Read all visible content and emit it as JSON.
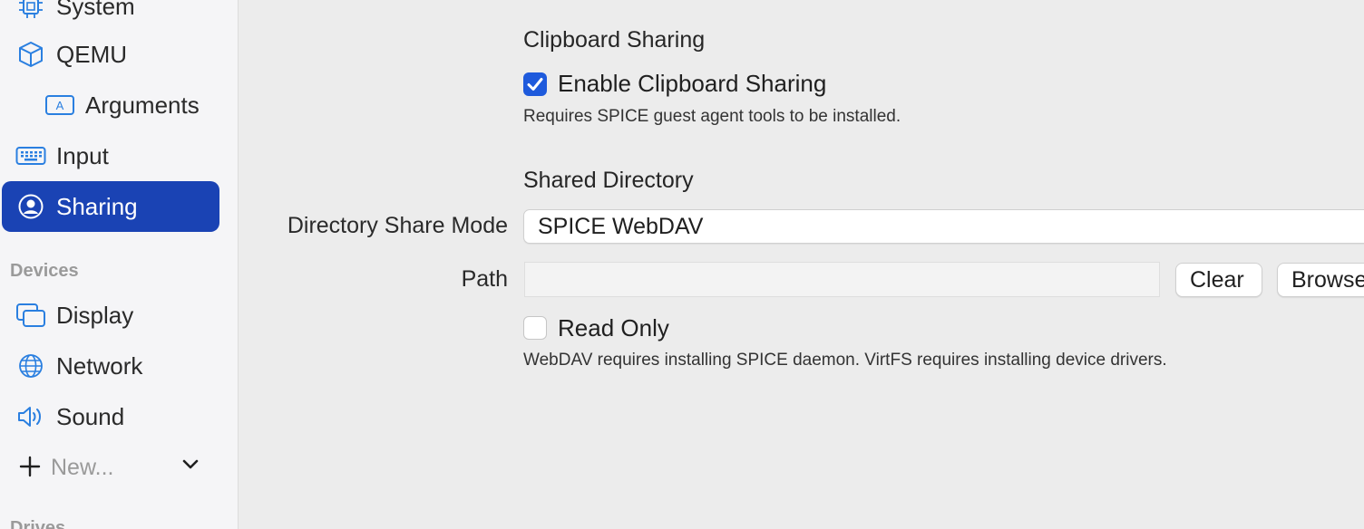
{
  "sidebar": {
    "items": [
      {
        "label": "System",
        "icon": "cpu-icon"
      },
      {
        "label": "QEMU",
        "icon": "cube-icon"
      },
      {
        "label": "Arguments",
        "icon": "text-field-icon"
      },
      {
        "label": "Input",
        "icon": "keyboard-icon"
      },
      {
        "label": "Sharing",
        "icon": "person-circle-icon",
        "selected": true
      },
      {
        "label": "Display",
        "icon": "display-icon"
      },
      {
        "label": "Network",
        "icon": "globe-icon"
      },
      {
        "label": "Sound",
        "icon": "speaker-icon"
      }
    ],
    "devices_header": "Devices",
    "new_label": "New...",
    "next_header": "Drives",
    "accent": "#1a43b4"
  },
  "clipboard": {
    "title": "Clipboard Sharing",
    "enable_label": "Enable Clipboard Sharing",
    "enable_checked": true,
    "hint": "Requires SPICE guest agent tools to be installed."
  },
  "shared_directory": {
    "title": "Shared Directory",
    "mode_label": "Directory Share Mode",
    "mode_value": "SPICE WebDAV",
    "path_label": "Path",
    "path_value": "",
    "clear_label": "Clear",
    "browse_label": "Browse...",
    "read_only_label": "Read Only",
    "read_only_checked": false,
    "hint": "WebDAV requires installing SPICE daemon. VirtFS requires installing device drivers."
  },
  "colors": {
    "checkbox_on": "#1e5adc",
    "icon_blue": "#2a7fe0"
  }
}
